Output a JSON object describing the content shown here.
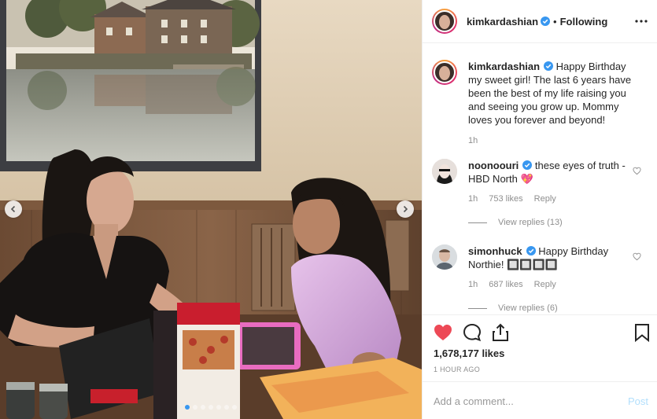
{
  "post": {
    "username": "kimkardashian",
    "separator": "•",
    "follow_status": "Following",
    "caption": "Happy Birthday my sweet girl! The last 6 years have been the best of my life raising you and seeing you grow up. Mommy loves you forever and beyond!",
    "caption_time": "1h",
    "likes": "1,678,177 likes",
    "time_ago": "1 HOUR AGO",
    "photo_page": 1,
    "photo_count": 7
  },
  "comments": [
    {
      "username": "noonoouri",
      "text": "these eyes of truth - HBD North 💖",
      "time": "1h",
      "likes": "753 likes",
      "reply": "Reply",
      "view_replies": "View replies (13)"
    },
    {
      "username": "simonhuck",
      "text": "Happy Birthday Northie! 🔲🔲🔲🔲",
      "time": "1h",
      "likes": "687 likes",
      "reply": "Reply",
      "view_replies": "View replies (6)"
    }
  ],
  "add_comment": {
    "placeholder": "Add a comment...",
    "post_label": "Post"
  },
  "icons": {
    "verified": "verified-badge-icon",
    "more": "more-options-icon",
    "like": "heart-filled-icon",
    "comment": "comment-bubble-icon",
    "share": "share-icon",
    "save": "bookmark-icon",
    "prev": "chevron-left-icon",
    "next": "chevron-right-icon"
  },
  "colors": {
    "liked": "#ed4956",
    "verified": "#3897f0",
    "post_disabled": "#b2dffc"
  }
}
